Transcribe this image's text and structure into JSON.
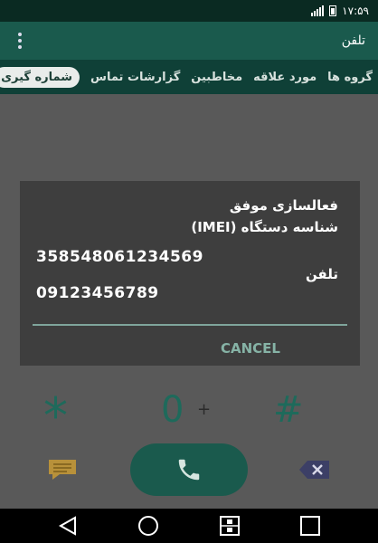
{
  "status_bar": {
    "time": "۱۷:۵۹"
  },
  "app_bar": {
    "title": "تلفن"
  },
  "tabs": [
    {
      "label": "شماره گیری",
      "active": true
    },
    {
      "label": "گزارشات تماس",
      "active": false
    },
    {
      "label": "مخاطبین",
      "active": false
    },
    {
      "label": "مورد علاقه",
      "active": false
    },
    {
      "label": "گروه ها",
      "active": false
    }
  ],
  "dialog": {
    "title": "فعالسازی موفق",
    "imei_label": "شناسه دستگاه (IMEI)",
    "imei_value": "358548061234569",
    "phone_label": "تلفن",
    "phone_value": "09123456789",
    "cancel_label": "CANCEL"
  },
  "dialpad": {
    "star": "*",
    "zero": "0",
    "plus": "+",
    "hash": "#"
  },
  "colors": {
    "accent": "#1a5a4d",
    "accent_text": "#86b3a6"
  }
}
